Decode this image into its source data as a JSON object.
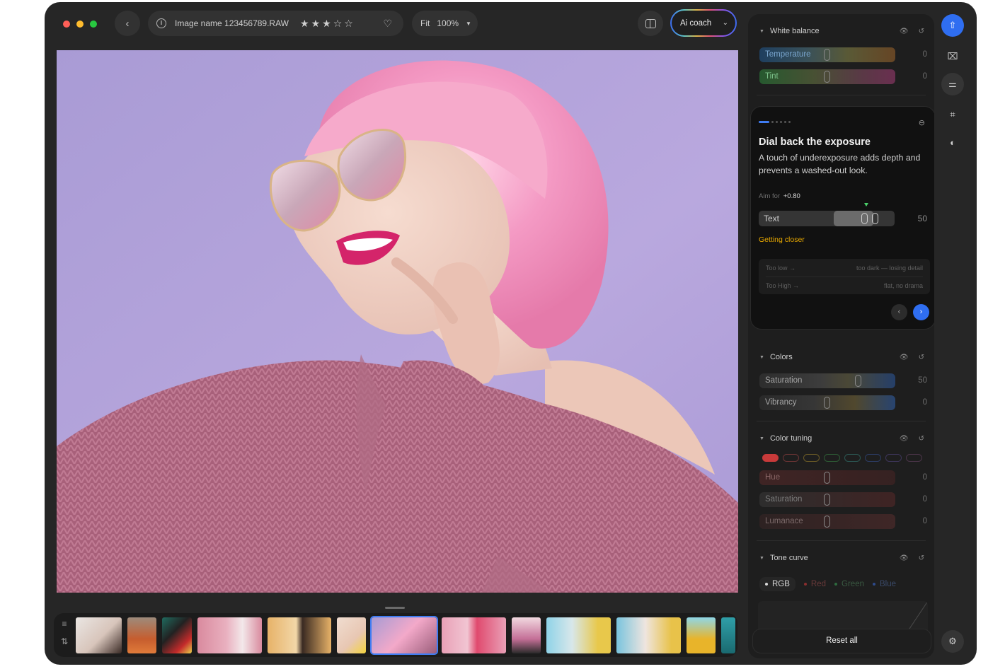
{
  "window": {
    "traffic_colors": [
      "#ff5f57",
      "#febc2e",
      "#28c840"
    ]
  },
  "topbar": {
    "back_icon": "chevron-left-icon",
    "file_name": "Image name 123456789.RAW",
    "rating": 3,
    "rating_max": 5,
    "stars": [
      "★",
      "★",
      "★",
      "☆",
      "☆"
    ],
    "heart_icon": "heart-icon",
    "fit_label": "Fit",
    "zoom": "100%",
    "ai_coach_label": "Ai coach"
  },
  "panel": {
    "white_balance": {
      "title": "White balance",
      "sliders": [
        {
          "label": "Temperature",
          "value": "0"
        },
        {
          "label": "Tint",
          "value": "0"
        }
      ]
    },
    "coach": {
      "title": "Dial back the exposure",
      "body": "A touch of underexposure adds depth and prevents a washed-out look.",
      "aim_label": "Aim for",
      "aim_value": "+0.80",
      "slider_label": "Text",
      "slider_value": "50",
      "status": "Getting closer",
      "hints": [
        {
          "left": "Too low →",
          "right": "too dark — losing detail"
        },
        {
          "left": "Too High →",
          "right": "flat, no drama"
        }
      ]
    },
    "colors": {
      "title": "Colors",
      "sliders": [
        {
          "label": "Saturation",
          "value": "50"
        },
        {
          "label": "Vibrancy",
          "value": "0"
        }
      ]
    },
    "color_tuning": {
      "title": "Color tuning",
      "swatches": [
        "#c83a3a",
        "#6a3434",
        "#6a5a26",
        "#2d5a34",
        "#2b5652",
        "#2c3b63",
        "#3d3559",
        "#4a3448"
      ],
      "sliders": [
        {
          "label": "Hue",
          "value": "0"
        },
        {
          "label": "Saturation",
          "value": "0"
        },
        {
          "label": "Lumanace",
          "value": "0"
        }
      ]
    },
    "tone_curve": {
      "title": "Tone curve",
      "tabs": [
        {
          "label": "RGB",
          "color": "#dadada"
        },
        {
          "label": "Red",
          "color": "#d64545"
        },
        {
          "label": "Green",
          "color": "#3f9a5a"
        },
        {
          "label": "Blue",
          "color": "#3f6bd6"
        }
      ]
    },
    "reset_label": "Reset all"
  },
  "rail": {
    "icons": [
      "export-icon",
      "masking-icon",
      "adjustments-icon",
      "crop-icon",
      "retouch-icon",
      "settings-icon"
    ]
  },
  "accent": "#2f6ef1"
}
